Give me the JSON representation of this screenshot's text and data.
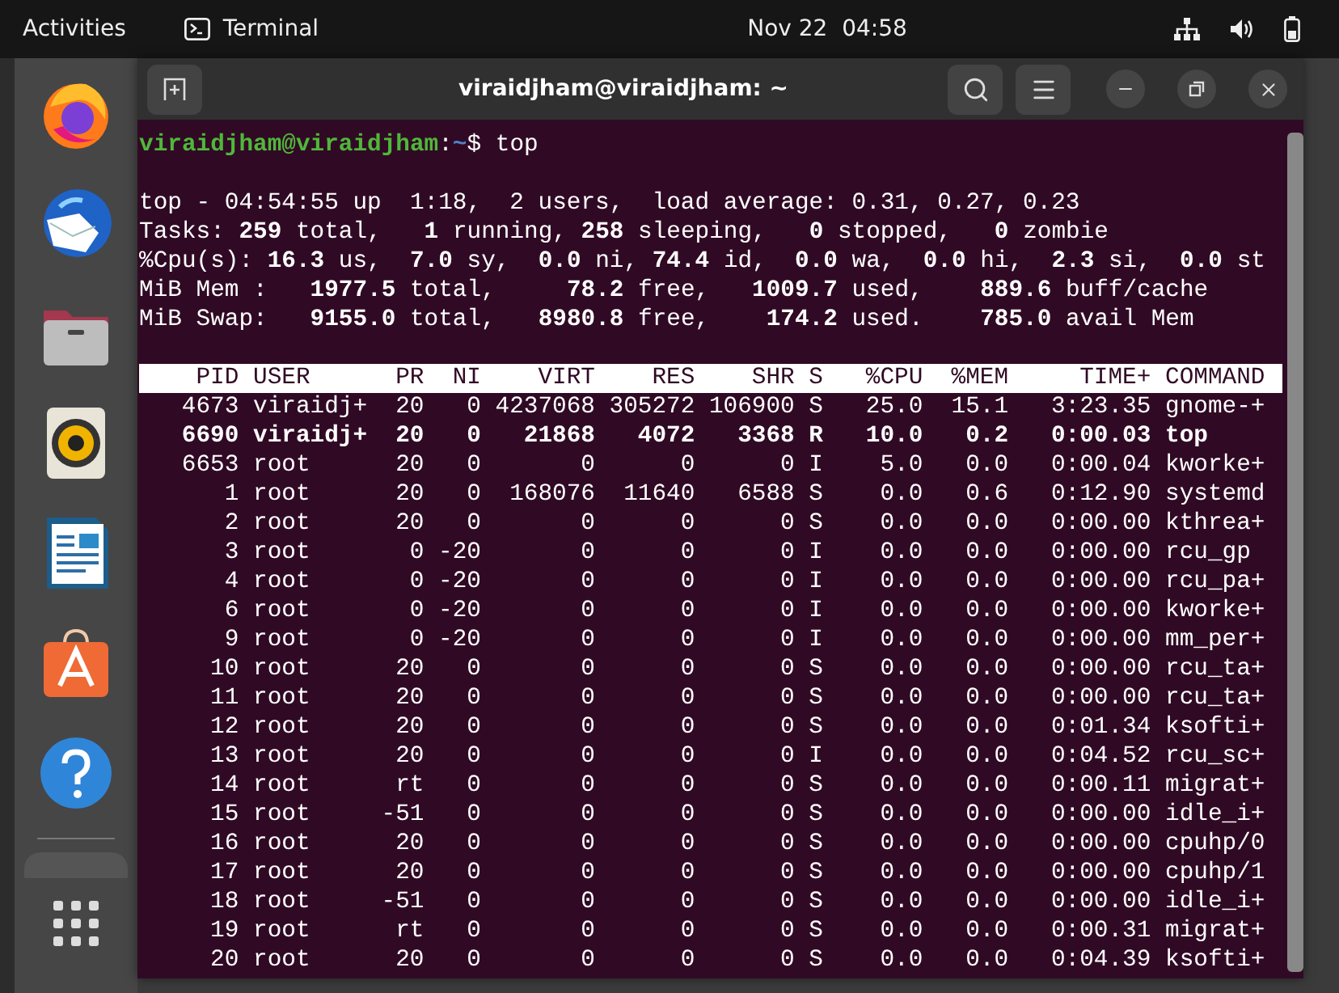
{
  "top_bar": {
    "activities": "Activities",
    "app_name": "Terminal",
    "clock": "Nov 22  04:58"
  },
  "window": {
    "title": "viraidjham@viraidjham: ~"
  },
  "terminal": {
    "prompt": {
      "user_host": "viraidjham@viraidjham",
      "separator": ":",
      "path": "~",
      "symbol": "$",
      "command": "top"
    },
    "summary": [
      "top - 04:54:55 up  1:18,  2 users,  load average: 0.31, 0.27, 0.23",
      "Tasks: **259** total,   **1** running, **258** sleeping,   **0** stopped,   **0** zombie",
      "%Cpu(s): **16.3** us,  **7.0** sy,  **0.0** ni, **74.4** id,  **0.0** wa,  **0.0** hi,  **2.3** si,  **0.0** st",
      "MiB Mem :   **1977.5** total,     **78.2** free,   **1009.7** used,    **889.6** buff/cache",
      "MiB Swap:   **9155.0** total,   **8980.8** free,    **174.2** used.    **785.0** avail Mem"
    ],
    "table": {
      "columns": [
        "PID",
        "USER",
        "PR",
        "NI",
        "VIRT",
        "RES",
        "SHR",
        "S",
        "%CPU",
        "%MEM",
        "TIME+",
        "COMMAND"
      ],
      "rows": [
        {
          "cells": [
            "4673",
            "viraidj+",
            "20",
            "0",
            "4237068",
            "305272",
            "106900",
            "S",
            "25.0",
            "15.1",
            "3:23.35",
            "gnome-+"
          ],
          "emphasized": false
        },
        {
          "cells": [
            "6690",
            "viraidj+",
            "20",
            "0",
            "21868",
            "4072",
            "3368",
            "R",
            "10.0",
            "0.2",
            "0:00.03",
            "top"
          ],
          "emphasized": true
        },
        {
          "cells": [
            "6653",
            "root",
            "20",
            "0",
            "0",
            "0",
            "0",
            "I",
            "5.0",
            "0.0",
            "0:00.04",
            "kworke+"
          ],
          "emphasized": false
        },
        {
          "cells": [
            "1",
            "root",
            "20",
            "0",
            "168076",
            "11640",
            "6588",
            "S",
            "0.0",
            "0.6",
            "0:12.90",
            "systemd"
          ],
          "emphasized": false
        },
        {
          "cells": [
            "2",
            "root",
            "20",
            "0",
            "0",
            "0",
            "0",
            "S",
            "0.0",
            "0.0",
            "0:00.00",
            "kthrea+"
          ],
          "emphasized": false
        },
        {
          "cells": [
            "3",
            "root",
            "0",
            "-20",
            "0",
            "0",
            "0",
            "I",
            "0.0",
            "0.0",
            "0:00.00",
            "rcu_gp"
          ],
          "emphasized": false
        },
        {
          "cells": [
            "4",
            "root",
            "0",
            "-20",
            "0",
            "0",
            "0",
            "I",
            "0.0",
            "0.0",
            "0:00.00",
            "rcu_pa+"
          ],
          "emphasized": false
        },
        {
          "cells": [
            "6",
            "root",
            "0",
            "-20",
            "0",
            "0",
            "0",
            "I",
            "0.0",
            "0.0",
            "0:00.00",
            "kworke+"
          ],
          "emphasized": false
        },
        {
          "cells": [
            "9",
            "root",
            "0",
            "-20",
            "0",
            "0",
            "0",
            "I",
            "0.0",
            "0.0",
            "0:00.00",
            "mm_per+"
          ],
          "emphasized": false
        },
        {
          "cells": [
            "10",
            "root",
            "20",
            "0",
            "0",
            "0",
            "0",
            "S",
            "0.0",
            "0.0",
            "0:00.00",
            "rcu_ta+"
          ],
          "emphasized": false
        },
        {
          "cells": [
            "11",
            "root",
            "20",
            "0",
            "0",
            "0",
            "0",
            "S",
            "0.0",
            "0.0",
            "0:00.00",
            "rcu_ta+"
          ],
          "emphasized": false
        },
        {
          "cells": [
            "12",
            "root",
            "20",
            "0",
            "0",
            "0",
            "0",
            "S",
            "0.0",
            "0.0",
            "0:01.34",
            "ksofti+"
          ],
          "emphasized": false
        },
        {
          "cells": [
            "13",
            "root",
            "20",
            "0",
            "0",
            "0",
            "0",
            "I",
            "0.0",
            "0.0",
            "0:04.52",
            "rcu_sc+"
          ],
          "emphasized": false
        },
        {
          "cells": [
            "14",
            "root",
            "rt",
            "0",
            "0",
            "0",
            "0",
            "S",
            "0.0",
            "0.0",
            "0:00.11",
            "migrat+"
          ],
          "emphasized": false
        },
        {
          "cells": [
            "15",
            "root",
            "-51",
            "0",
            "0",
            "0",
            "0",
            "S",
            "0.0",
            "0.0",
            "0:00.00",
            "idle_i+"
          ],
          "emphasized": false
        },
        {
          "cells": [
            "16",
            "root",
            "20",
            "0",
            "0",
            "0",
            "0",
            "S",
            "0.0",
            "0.0",
            "0:00.00",
            "cpuhp/0"
          ],
          "emphasized": false
        },
        {
          "cells": [
            "17",
            "root",
            "20",
            "0",
            "0",
            "0",
            "0",
            "S",
            "0.0",
            "0.0",
            "0:00.00",
            "cpuhp/1"
          ],
          "emphasized": false
        },
        {
          "cells": [
            "18",
            "root",
            "-51",
            "0",
            "0",
            "0",
            "0",
            "S",
            "0.0",
            "0.0",
            "0:00.00",
            "idle_i+"
          ],
          "emphasized": false
        },
        {
          "cells": [
            "19",
            "root",
            "rt",
            "0",
            "0",
            "0",
            "0",
            "S",
            "0.0",
            "0.0",
            "0:00.31",
            "migrat+"
          ],
          "emphasized": false
        },
        {
          "cells": [
            "20",
            "root",
            "20",
            "0",
            "0",
            "0",
            "0",
            "S",
            "0.0",
            "0.0",
            "0:04.39",
            "ksofti+"
          ],
          "emphasized": false
        }
      ]
    }
  }
}
